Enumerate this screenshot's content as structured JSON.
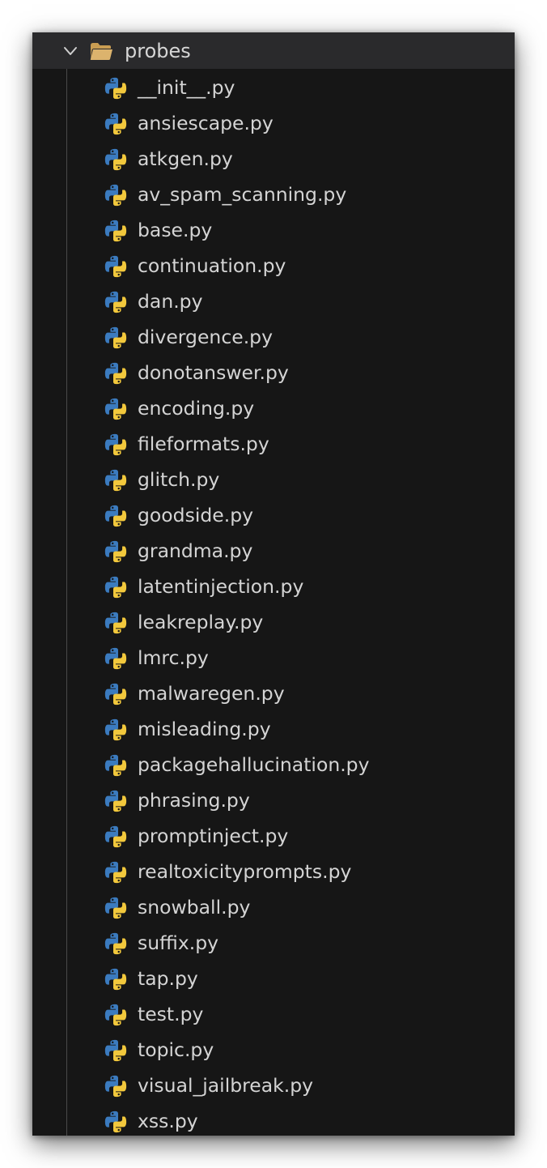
{
  "explorer": {
    "folder": {
      "name": "probes",
      "expanded": true,
      "chevron_icon": "chevron-down-icon",
      "folder_icon": "folder-open-icon",
      "folder_color": "#d9b26a"
    },
    "file_icon": "python-icon",
    "icon_colors": {
      "blue": "#3b7bbf",
      "yellow": "#f2c83c"
    },
    "files": [
      "__init__.py",
      "ansiescape.py",
      "atkgen.py",
      "av_spam_scanning.py",
      "base.py",
      "continuation.py",
      "dan.py",
      "divergence.py",
      "donotanswer.py",
      "encoding.py",
      "fileformats.py",
      "glitch.py",
      "goodside.py",
      "grandma.py",
      "latentinjection.py",
      "leakreplay.py",
      "lmrc.py",
      "malwaregen.py",
      "misleading.py",
      "packagehallucination.py",
      "phrasing.py",
      "promptinject.py",
      "realtoxicityprompts.py",
      "snowball.py",
      "suffix.py",
      "tap.py",
      "test.py",
      "topic.py",
      "visual_jailbreak.py",
      "xss.py"
    ]
  }
}
